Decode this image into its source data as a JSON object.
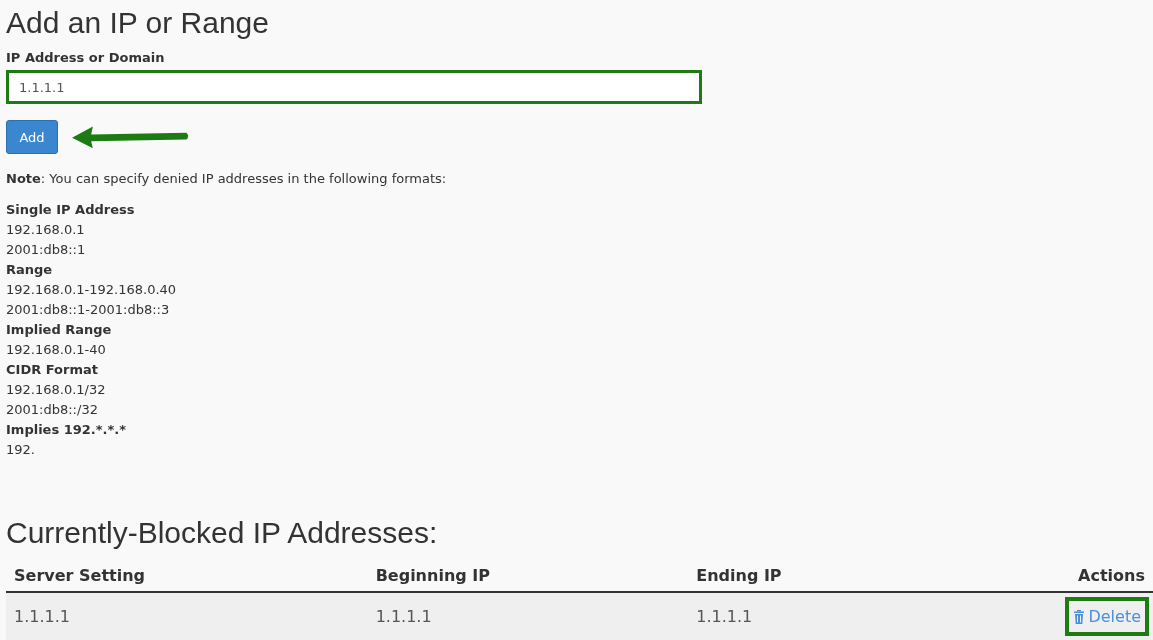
{
  "title": "Add an IP or Range",
  "field": {
    "label": "IP Address or Domain",
    "value": "1.1.1.1"
  },
  "add_button": "Add",
  "note": "**Note**: You can specify denied IP addresses in the following formats:",
  "formats": [
    {
      "kind": "heading",
      "text": "Single IP Address"
    },
    {
      "kind": "example",
      "text": "192.168.0.1"
    },
    {
      "kind": "example",
      "text": "2001:db8::1"
    },
    {
      "kind": "heading",
      "text": "Range"
    },
    {
      "kind": "example",
      "text": "192.168.0.1-192.168.0.40"
    },
    {
      "kind": "example",
      "text": "2001:db8::1-2001:db8::3"
    },
    {
      "kind": "heading",
      "text": "Implied Range"
    },
    {
      "kind": "example",
      "text": "192.168.0.1-40"
    },
    {
      "kind": "heading",
      "text": "CIDR Format"
    },
    {
      "kind": "example",
      "text": "192.168.0.1/32"
    },
    {
      "kind": "example",
      "text": "2001:db8::/32"
    },
    {
      "kind": "heading",
      "text": "Implies 192.*.*.*"
    },
    {
      "kind": "example",
      "text": "192."
    }
  ],
  "blocked_heading": "Currently-Blocked IP Addresses:",
  "table": {
    "columns": [
      "Server Setting",
      "Beginning IP",
      "Ending IP",
      "Actions"
    ],
    "rows": [
      {
        "cells": [
          "1.1.1.1",
          "1.1.1.1",
          "1.1.1.1"
        ],
        "action": "Delete"
      }
    ]
  }
}
